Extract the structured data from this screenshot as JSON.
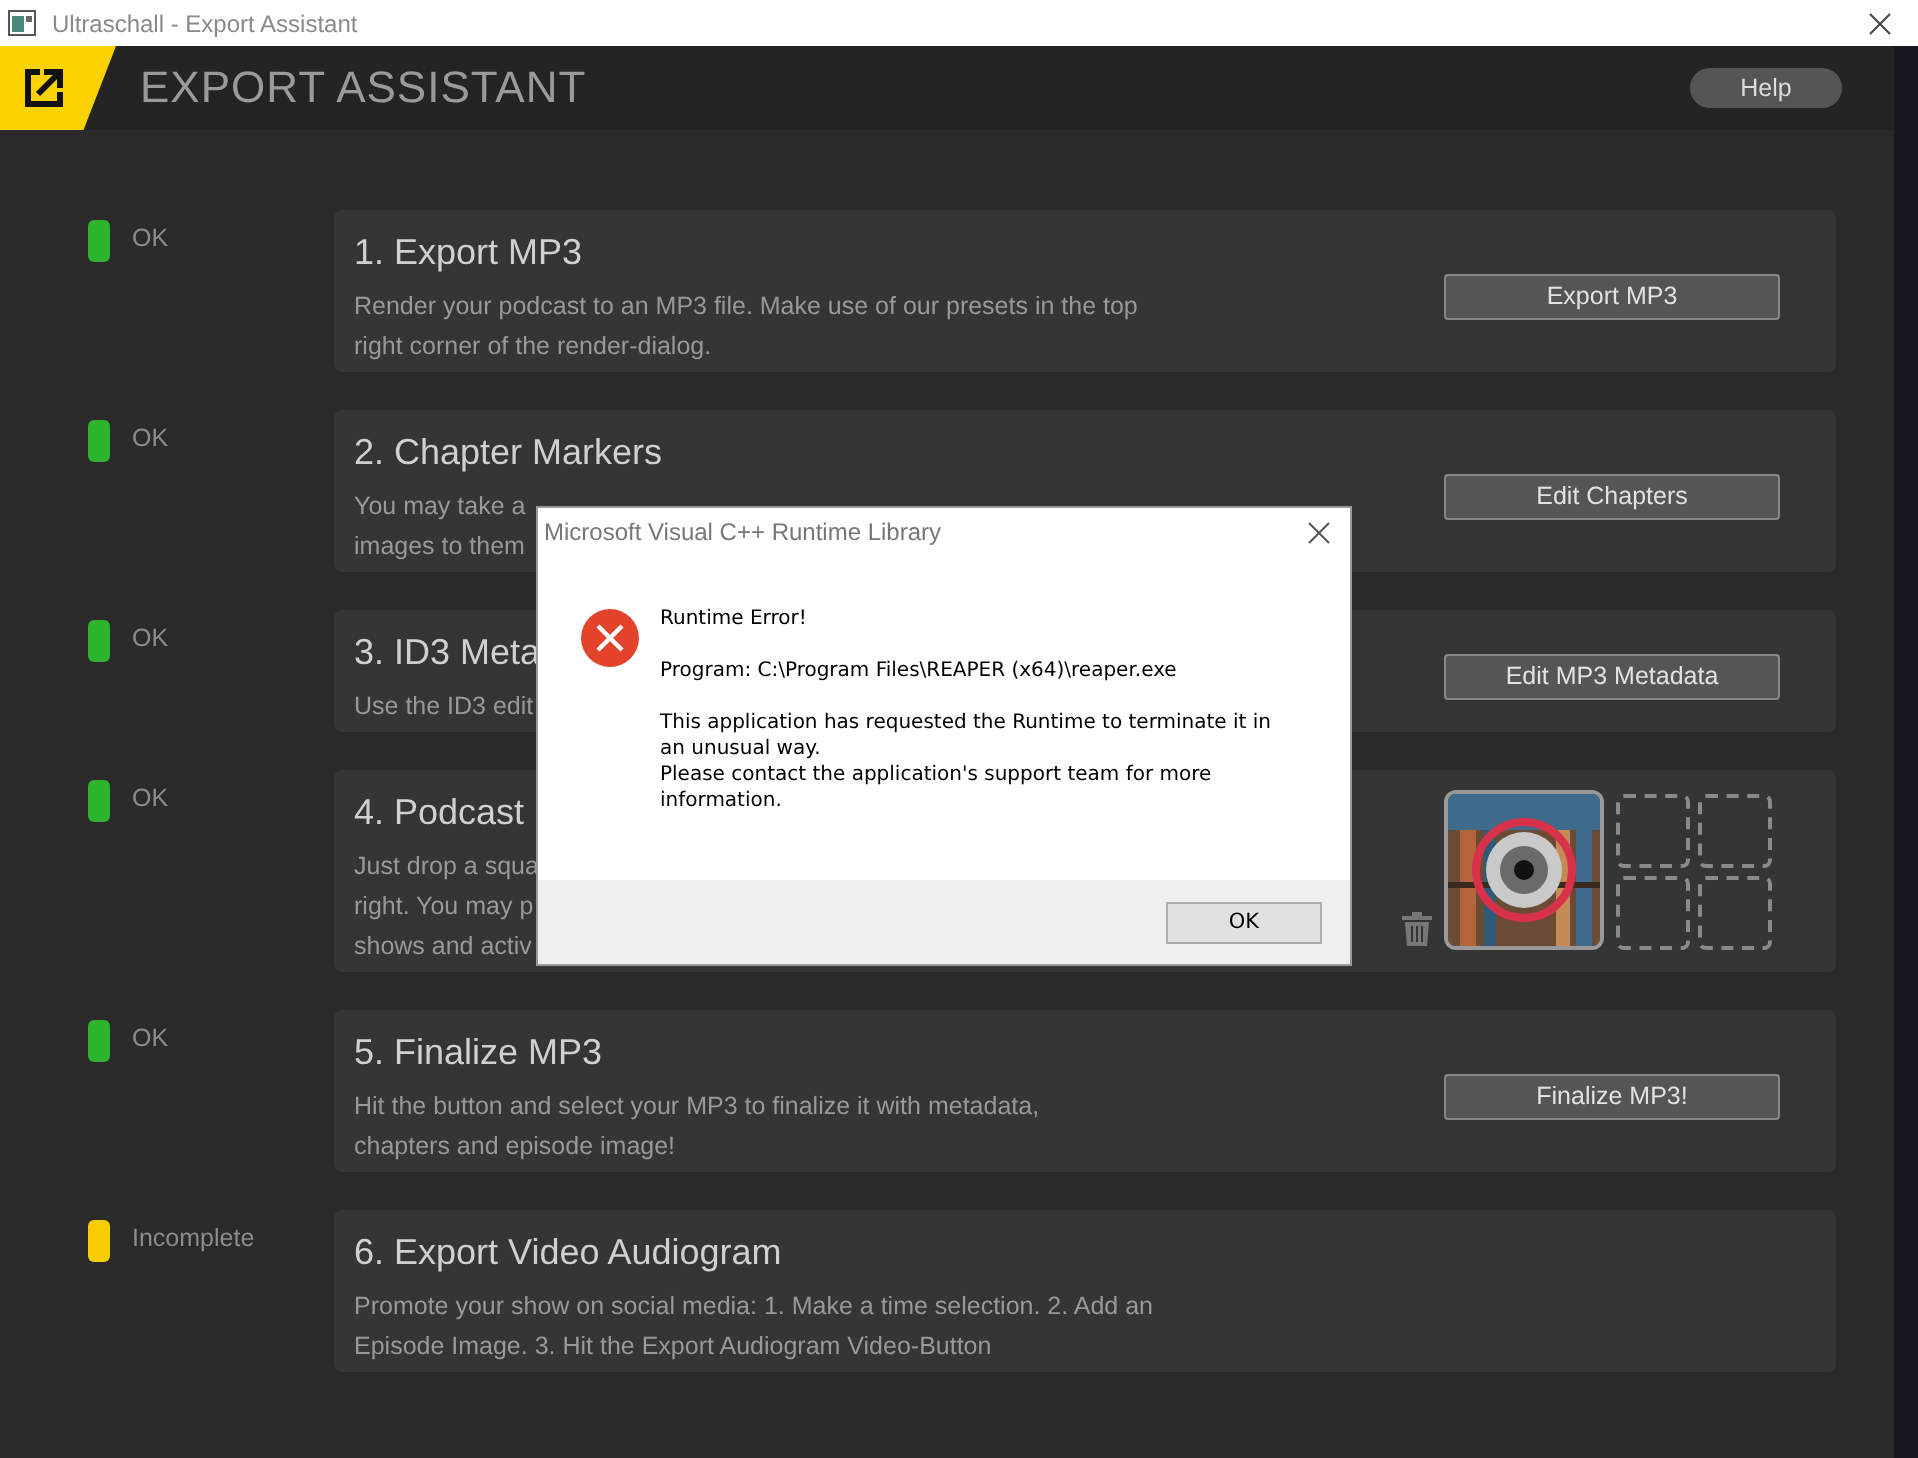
{
  "window": {
    "title": "Ultraschall - Export Assistant"
  },
  "header": {
    "title": "EXPORT ASSISTANT",
    "help_button": "Help"
  },
  "steps": [
    {
      "color": "#2cb42c",
      "status_label": "OK",
      "title": "1. Export MP3",
      "description": "Render your podcast to an MP3 file. Make use of our presets in the top\nright corner of the render-dialog.",
      "button": "Export MP3"
    },
    {
      "color": "#2cb42c",
      "status_label": "OK",
      "title": "2. Chapter Markers",
      "description": "You may take a\nimages to them",
      "button": "Edit Chapters"
    },
    {
      "color": "#2cb42c",
      "status_label": "OK",
      "title": "3. ID3 Meta",
      "description": "Use the ID3 edit",
      "button": "Edit MP3 Metadata"
    },
    {
      "color": "#2cb42c",
      "status_label": "OK",
      "title": "4. Podcast",
      "description": "Just drop a squa\nright. You may p\nshows and activ",
      "episode_images": {
        "slots": [
          {
            "empty": true
          },
          {
            "empty": true
          },
          {
            "empty": true
          },
          {
            "empty": true
          }
        ]
      }
    },
    {
      "color": "#2cb42c",
      "status_label": "OK",
      "title": "5. Finalize MP3",
      "description": "Hit the button and select your MP3 to finalize it with metadata,\nchapters and episode image!",
      "button": "Finalize MP3!"
    },
    {
      "color": "#f6cd00",
      "status_label": "Incomplete",
      "title": "6. Export Video Audiogram",
      "description": "Promote your show on social media: 1. Make a time selection. 2. Add an\nEpisode Image. 3. Hit the Export Audiogram Video-Button"
    }
  ],
  "dialog": {
    "title": "Microsoft Visual C++ Runtime Library",
    "heading": "Runtime Error!",
    "program": "Program: C:\\Program Files\\REAPER (x64)\\reaper.exe",
    "message": "This application has requested the Runtime to terminate it in\nan unusual way.\nPlease contact the application's support team for more\ninformation.",
    "button": "OK"
  }
}
